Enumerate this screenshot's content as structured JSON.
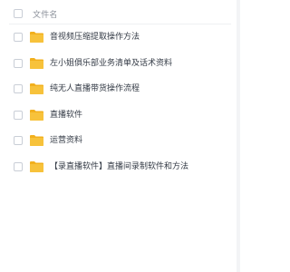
{
  "header": {
    "column_label": "文件名"
  },
  "files": [
    {
      "name": "音视频压缩提取操作方法",
      "icon": "folder-icon"
    },
    {
      "name": "左小姐俱乐部业务清单及话术资料",
      "icon": "folder-icon"
    },
    {
      "name": "纯无人直播带货操作流程",
      "icon": "folder-icon"
    },
    {
      "name": "直播软件",
      "icon": "folder-icon"
    },
    {
      "name": "运营资料",
      "icon": "folder-icon"
    },
    {
      "name": "【录直播软件】直播间录制软件和方法",
      "icon": "folder-icon"
    }
  ],
  "colors": {
    "folder": "#f7c23b",
    "folder_tab": "#f2b01e",
    "text": "#333a45",
    "header_text": "#8a8f99"
  }
}
